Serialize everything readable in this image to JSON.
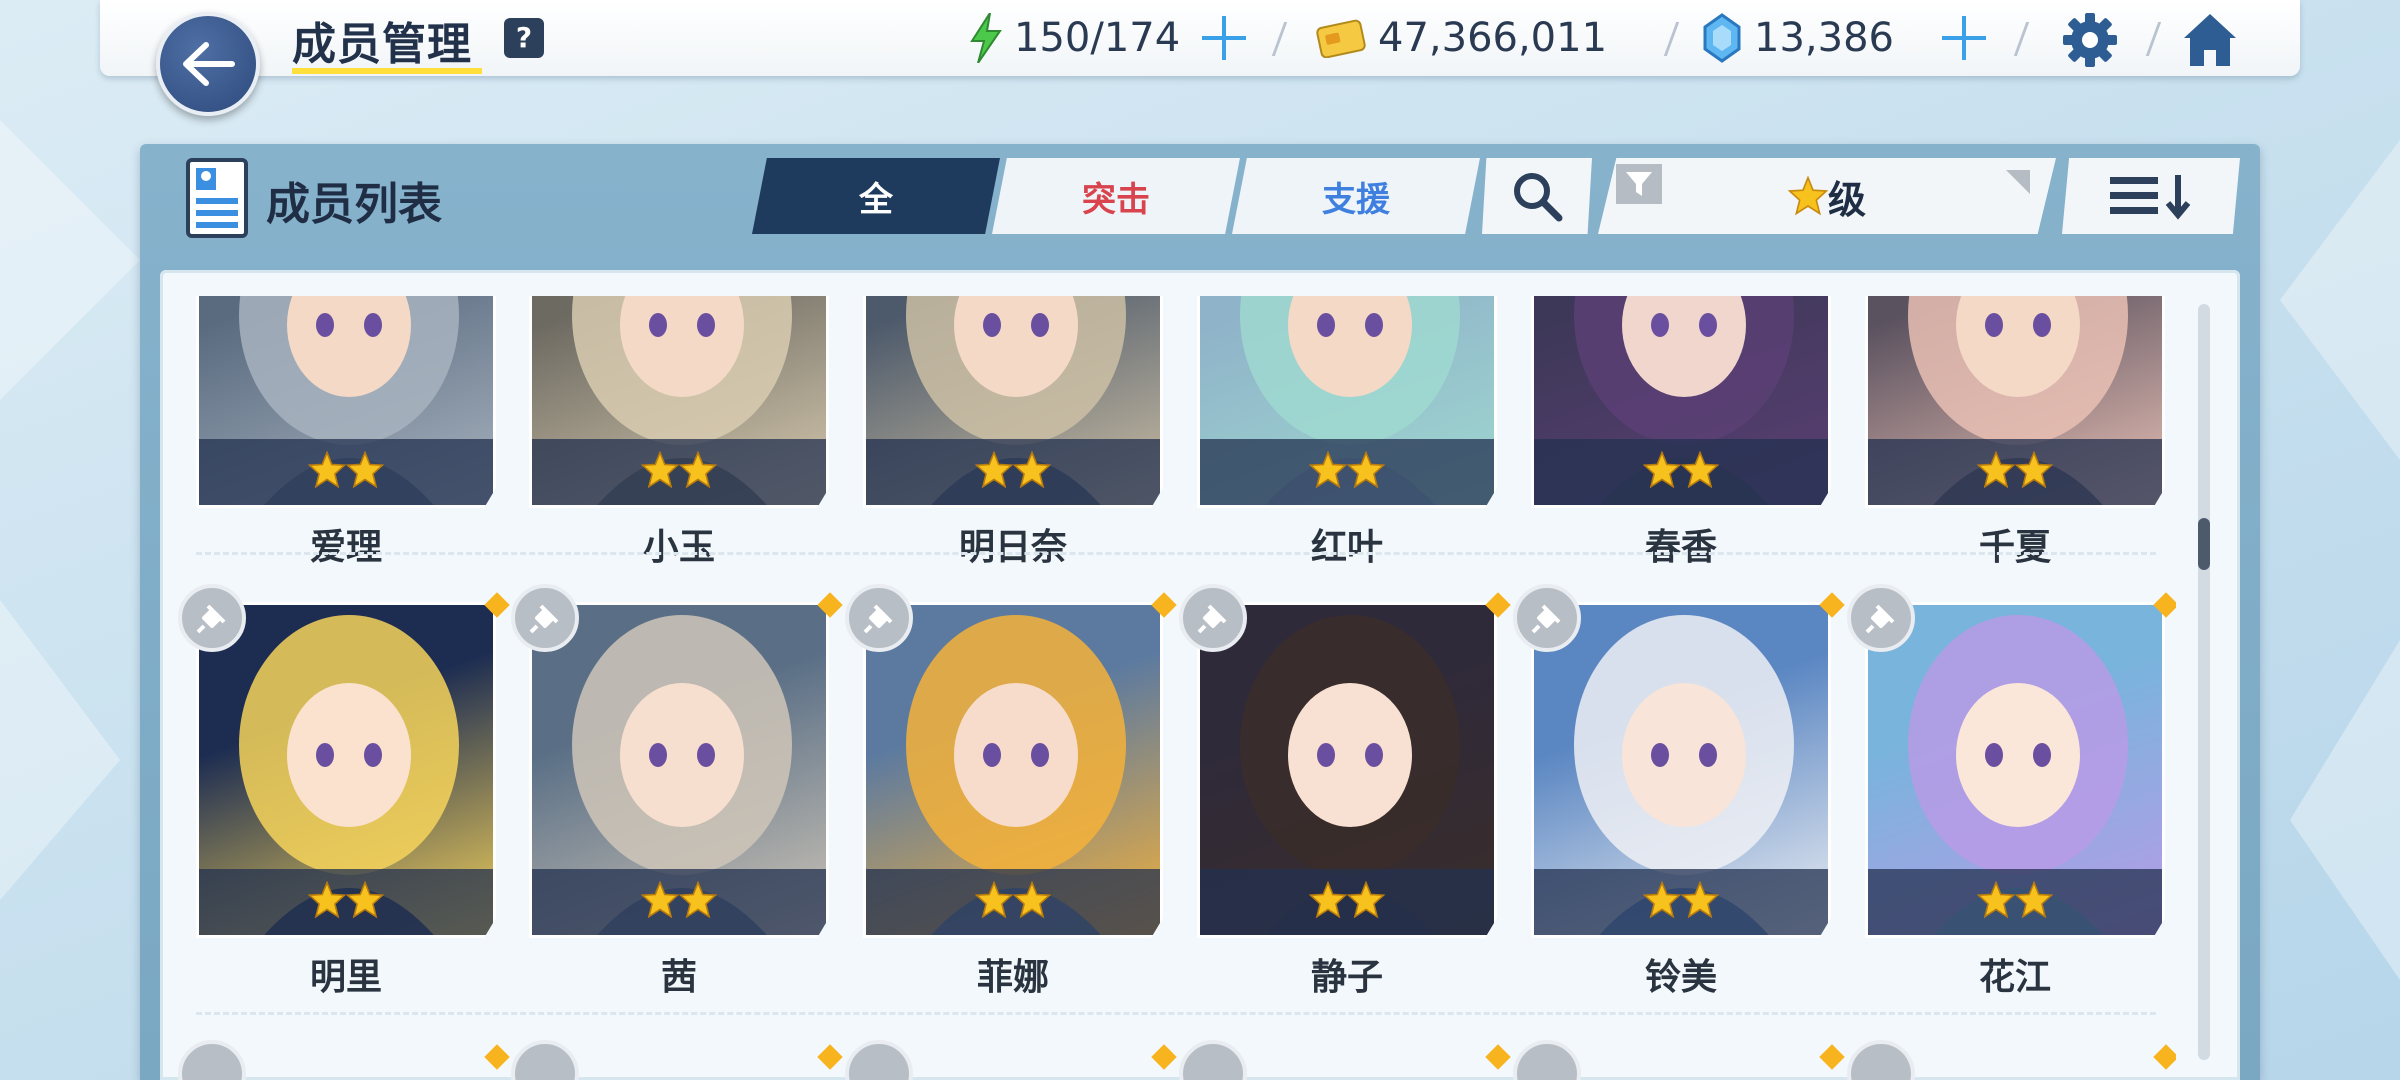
{
  "header": {
    "title": "成员管理",
    "help_label": "?",
    "ap": "150/174",
    "credits": "47,366,011",
    "gems": "13,386"
  },
  "panel": {
    "title": "成员列表",
    "tabs": {
      "all": "全",
      "assault": "突击",
      "support": "支援"
    },
    "sort_label": "级"
  },
  "colors": {
    "accent_navy": "#1e3b5d",
    "assault_red": "#d8434d",
    "support_blue": "#3f7fe0",
    "star_gold": "#f7c21d",
    "highlight_yellow": "#ffdf3b"
  },
  "members_row1": [
    {
      "name": "爱理",
      "stars": 2
    },
    {
      "name": "小玉",
      "stars": 2
    },
    {
      "name": "明日奈",
      "stars": 2
    },
    {
      "name": "红叶",
      "stars": 2
    },
    {
      "name": "春香",
      "stars": 2
    },
    {
      "name": "千夏",
      "stars": 2
    }
  ],
  "members_row2": [
    {
      "name": "明里",
      "stars": 2
    },
    {
      "name": "茜",
      "stars": 2
    },
    {
      "name": "菲娜",
      "stars": 2
    },
    {
      "name": "静子",
      "stars": 2
    },
    {
      "name": "铃美",
      "stars": 2
    },
    {
      "name": "花江",
      "stars": 2
    }
  ]
}
